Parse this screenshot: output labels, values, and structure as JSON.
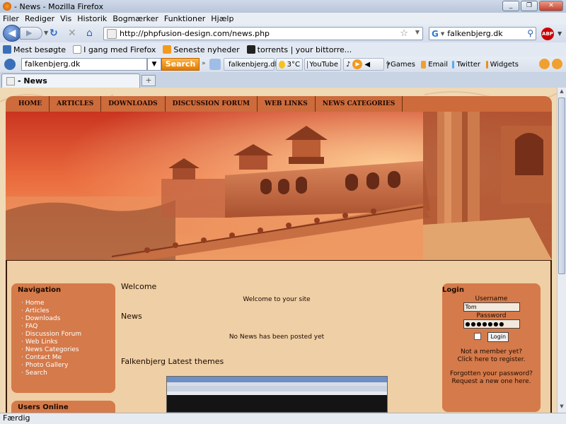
{
  "window": {
    "title": "- News - Mozilla Firefox",
    "min": "_",
    "max": "❐",
    "close": "✕"
  },
  "menu": [
    "Filer",
    "Rediger",
    "Vis",
    "Historik",
    "Bogmærker",
    "Funktioner",
    "Hjælp"
  ],
  "navigation": {
    "url": "http://phpfusion-design.com/news.php",
    "search_value": "falkenbjerg.dk",
    "abp": "ABP"
  },
  "bookmarks": [
    {
      "label": "Mest besøgte",
      "icon": "most-visited-icon",
      "color": "#3a6fb8"
    },
    {
      "label": "I gang med Firefox",
      "icon": "page-icon",
      "color": "#ffffff"
    },
    {
      "label": "Seneste nyheder",
      "icon": "rss-icon",
      "color": "#f39a1d"
    },
    {
      "label": "torrents | your bittorre...",
      "icon": "torrent-icon",
      "color": "#222222"
    }
  ],
  "toolbar2": {
    "input_value": "falkenbjerg.dk",
    "search_label": "Search",
    "items": [
      {
        "label": "falkenbjerg.dk",
        "icon": "site-icon",
        "color": "#4caf50"
      },
      {
        "label": "3°C",
        "icon": "weather-icon",
        "color": "#f7c21a"
      },
      {
        "label": "YouTube",
        "icon": "youtube-icon",
        "color": "#d32f2f"
      },
      {
        "label": "Games",
        "icon": "games-icon",
        "color": "#7a7a7a"
      },
      {
        "label": "Email",
        "icon": "email-icon",
        "color": "#f0a030"
      },
      {
        "label": "Twitter",
        "icon": "twitter-icon",
        "color": "#55acee"
      },
      {
        "label": "Widgets",
        "icon": "widgets-icon",
        "color": "#f08a1c"
      }
    ]
  },
  "tab": {
    "label": "- News",
    "new_tab": "+"
  },
  "site": {
    "nav": [
      "HOME",
      "ARTICLES",
      "DOWNLOADS",
      "DISCUSSION FORUM",
      "WEB LINKS",
      "NEWS CATEGORIES"
    ],
    "left": {
      "nav_title": "Navigation",
      "nav_items": [
        "Home",
        "Articles",
        "Downloads",
        "FAQ",
        "Discussion Forum",
        "Web Links",
        "News Categories",
        "Contact Me",
        "Photo Gallery",
        "Search"
      ],
      "users_online_title": "Users Online"
    },
    "center": {
      "welcome_title": "Welcome",
      "welcome_text": "Welcome to your site",
      "news_title": "News",
      "news_text": "No News has been posted yet",
      "themes_title": "Falkenbjerg Latest themes"
    },
    "login": {
      "title": "Login",
      "username_label": "Username",
      "username_value": "Tom",
      "password_label": "Password",
      "password_value": "●●●●●●●",
      "button": "Login",
      "not_member": "Not a member yet?",
      "register": "Click here to register.",
      "forgot": "Forgotten your password?",
      "request": "Request a new one here."
    }
  },
  "status": "Færdig"
}
